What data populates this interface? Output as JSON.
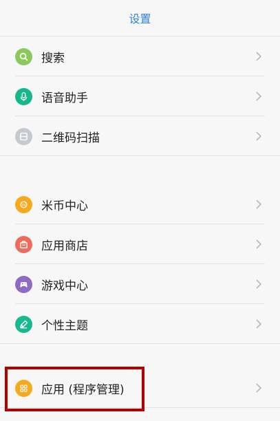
{
  "header": {
    "title": "设置"
  },
  "colors": {
    "accent": "#2d7fe0",
    "highlight": "#b20000"
  },
  "groups": [
    {
      "items": [
        {
          "label": "搜索",
          "icon": "search-icon",
          "color": "#8cc95b"
        },
        {
          "label": "语音助手",
          "icon": "microphone-icon",
          "color": "#14b88b"
        },
        {
          "label": "二维码扫描",
          "icon": "scanner-icon",
          "color": "#c4c9d2"
        }
      ]
    },
    {
      "items": [
        {
          "label": "米币中心",
          "icon": "mi-coin-icon",
          "color": "#f6a91d"
        },
        {
          "label": "应用商店",
          "icon": "shopping-bag-icon",
          "color": "#f06a5c"
        },
        {
          "label": "游戏中心",
          "icon": "gamepad-icon",
          "color": "#8e6ac5"
        },
        {
          "label": "个性主题",
          "icon": "brush-icon",
          "color": "#18b891"
        }
      ]
    },
    {
      "items": [
        {
          "label": "应用 (程序管理)",
          "icon": "apps-grid-icon",
          "color": "#f6a91d"
        }
      ]
    }
  ]
}
